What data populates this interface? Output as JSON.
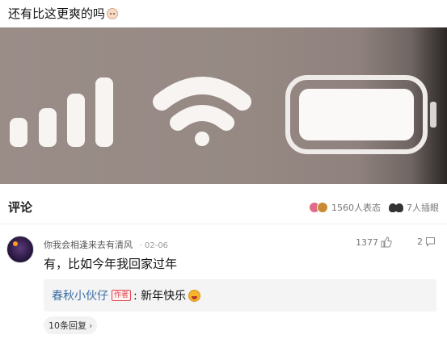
{
  "post": {
    "title": "还有比这更爽的吗",
    "emoji": "face-emoji"
  },
  "image": {
    "signal_bars": 4,
    "wifi_arcs": 3,
    "battery_level": 1.0
  },
  "comments_header": {
    "label": "评论",
    "reactions_text": "1560人表态",
    "viewers_text": "7人插眼"
  },
  "comment": {
    "author": "你我会相逢来去有清风",
    "date": "02-06",
    "likes": "1377",
    "replies": "2",
    "text": "有，比如今年我回家过年",
    "reply": {
      "author": "春秋小伙仔",
      "badge": "作者",
      "text": ": 新年快乐"
    },
    "more_replies": "10条回复"
  }
}
